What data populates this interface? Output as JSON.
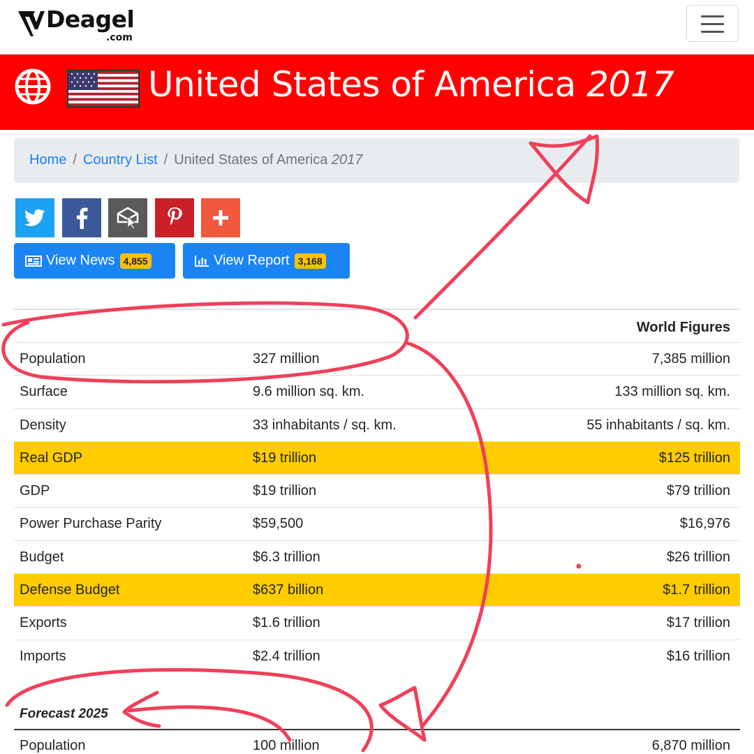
{
  "site": {
    "logo_text": "Deagel",
    "logo_sub": ".com"
  },
  "header": {
    "country": "United States of America",
    "year": "2017"
  },
  "breadcrumb": {
    "home": "Home",
    "separator": "/",
    "country_list": "Country List",
    "current": "United States of America",
    "current_year": "2017"
  },
  "share": {
    "colors": {
      "twitter": "#1da1f2",
      "facebook": "#3b5998",
      "email": "#5a5a5a",
      "pinterest": "#cb2027",
      "more": "#f1583c"
    }
  },
  "actions": {
    "news_label": "View News",
    "news_count": "4,855",
    "report_label": "View Report",
    "report_count": "3,168"
  },
  "table": {
    "world_header": "World Figures",
    "rows": [
      {
        "label": "Population",
        "value": "327 million",
        "world": "7,385 million",
        "highlight": false
      },
      {
        "label": "Surface",
        "value": "9.6 million sq. km.",
        "world": "133 million sq. km.",
        "highlight": false
      },
      {
        "label": "Density",
        "value": "33 inhabitants / sq. km.",
        "world": "55 inhabitants / sq. km.",
        "highlight": false
      },
      {
        "label": "Real GDP",
        "value": "$19 trillion",
        "world": "$125 trillion",
        "highlight": true
      },
      {
        "label": "GDP",
        "value": "$19 trillion",
        "world": "$79 trillion",
        "highlight": false
      },
      {
        "label": "Power Purchase Parity",
        "value": "$59,500",
        "world": "$16,976",
        "highlight": false
      },
      {
        "label": "Budget",
        "value": "$6.3 trillion",
        "world": "$26 trillion",
        "highlight": false
      },
      {
        "label": "Defense Budget",
        "value": "$637 billion",
        "world": "$1.7 trillion",
        "highlight": true
      },
      {
        "label": "Exports",
        "value": "$1.6 trillion",
        "world": "$17 trillion",
        "highlight": false
      },
      {
        "label": "Imports",
        "value": "$2.4 trillion",
        "world": "$16 trillion",
        "highlight": false
      }
    ]
  },
  "forecast": {
    "title": "Forecast 2025",
    "rows": [
      {
        "label": "Population",
        "value": "100 million",
        "world": "6,870 million"
      }
    ]
  },
  "colors": {
    "title_bar": "#ff0000",
    "highlight": "#ffcc00",
    "button": "#1a85f2",
    "badge": "#ffc107",
    "annotation": "#f0405a"
  }
}
